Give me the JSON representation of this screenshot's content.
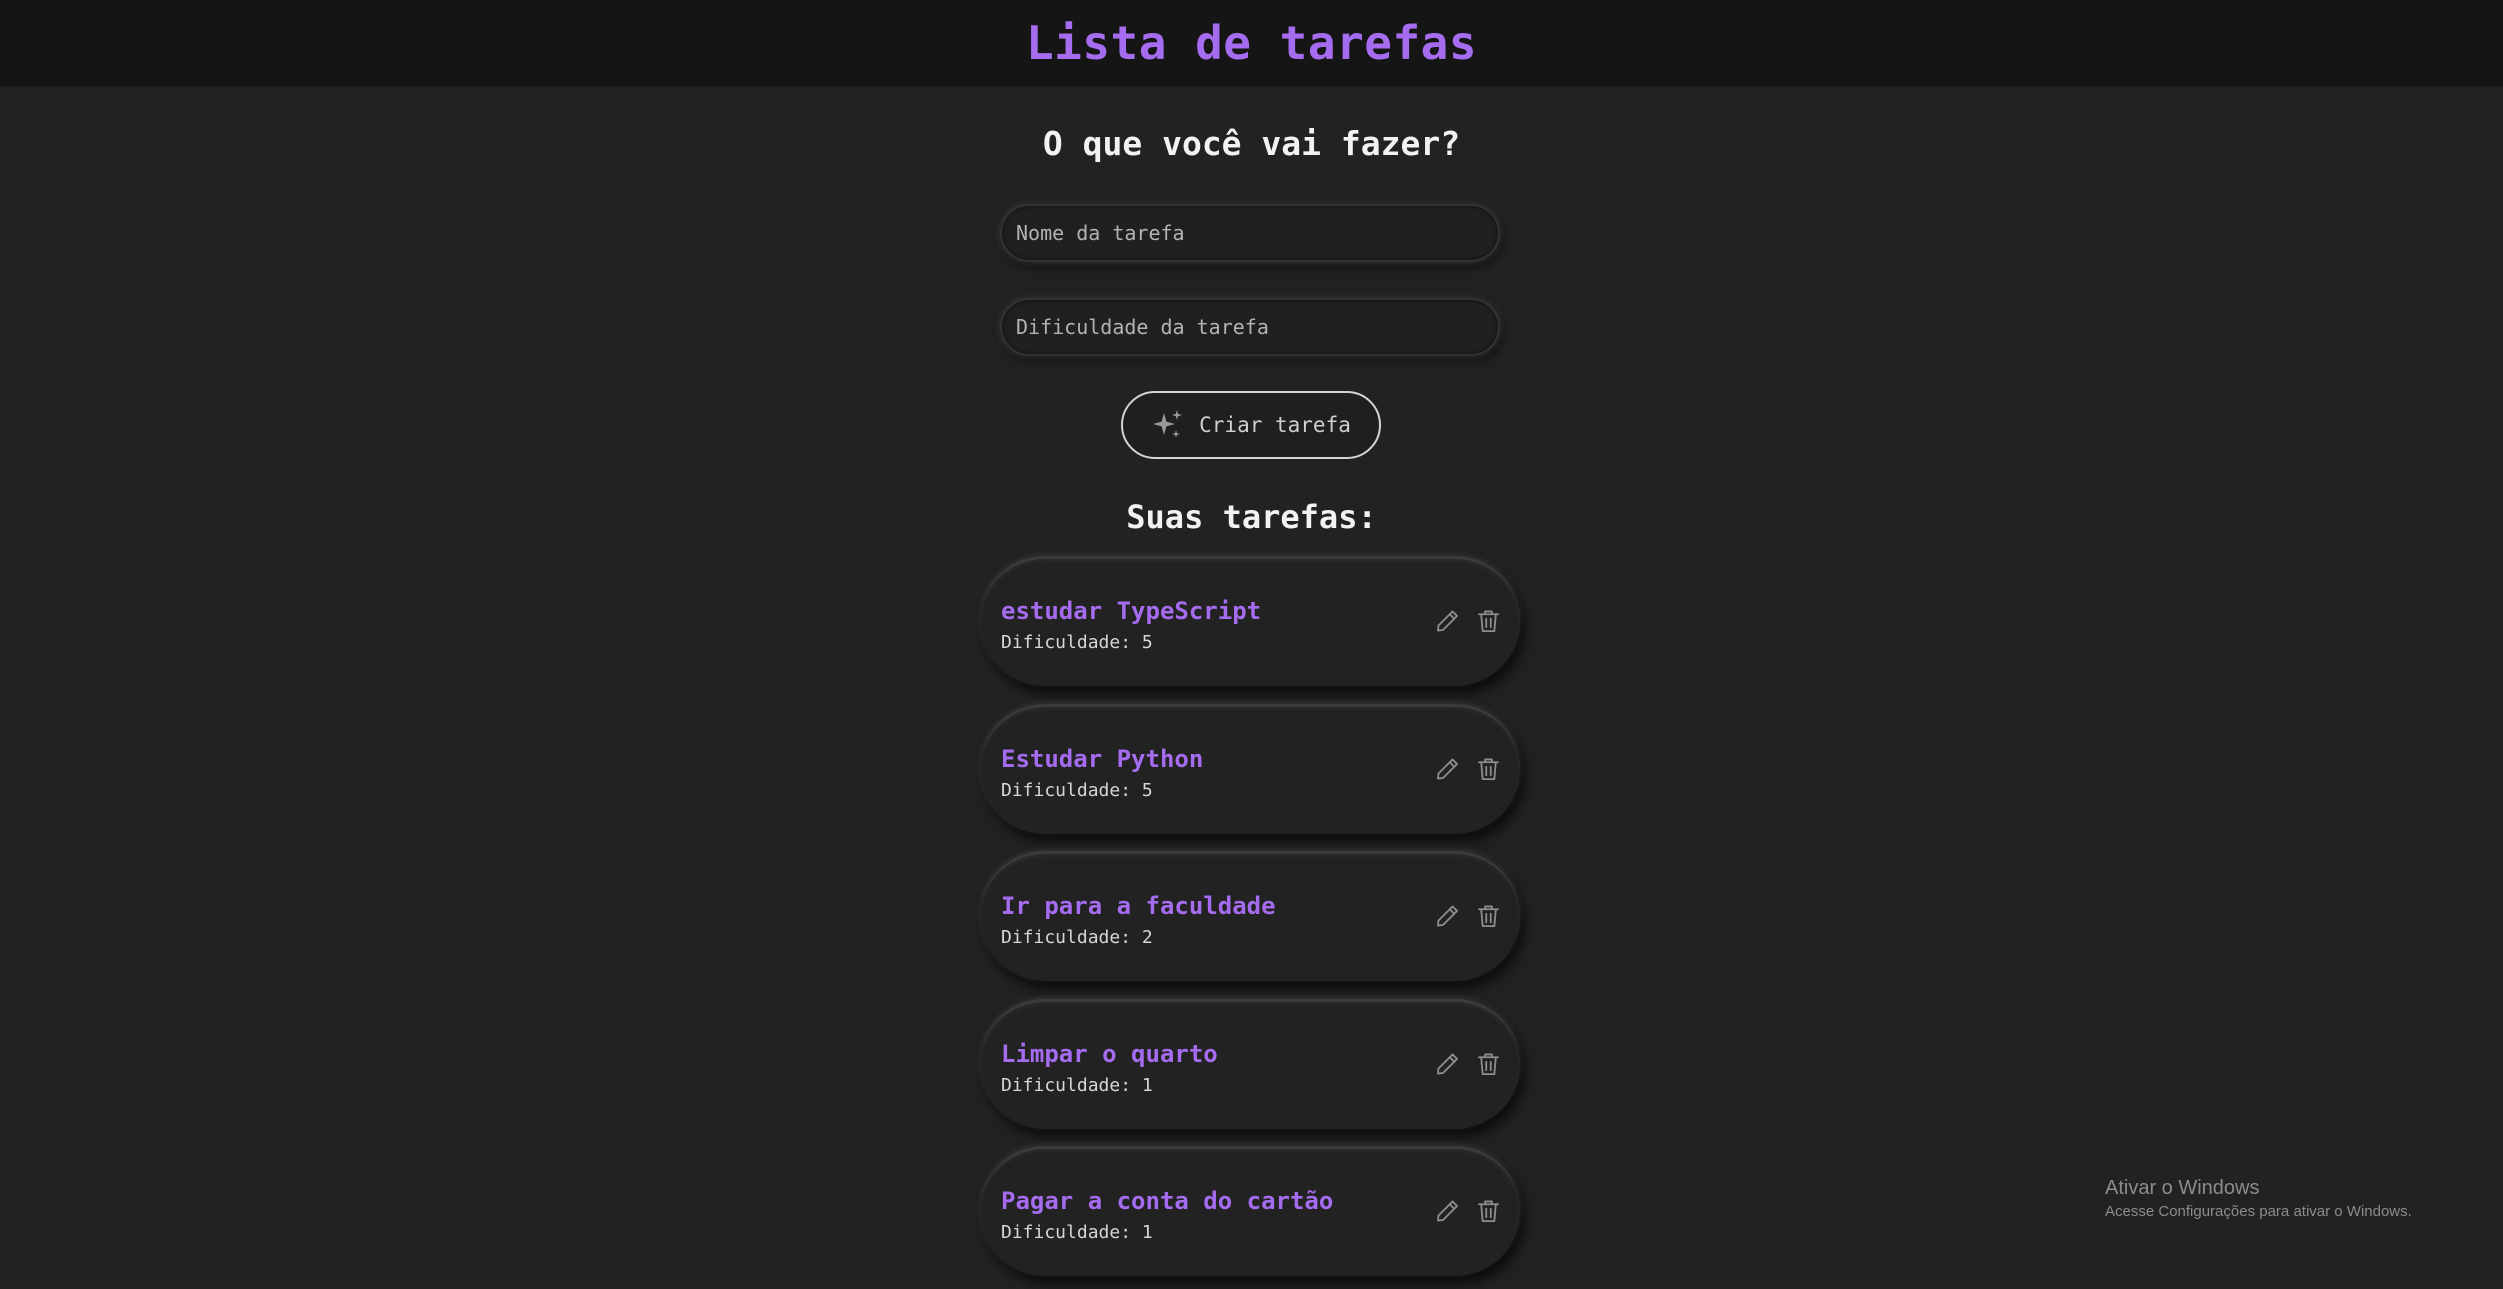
{
  "header": {
    "title": "Lista de tarefas"
  },
  "form": {
    "heading": "O que você vai fazer?",
    "name_placeholder": "Nome da tarefa",
    "difficulty_placeholder": "Dificuldade da tarefa",
    "create_label": "Criar tarefa",
    "create_icon": "sparkles-icon"
  },
  "list": {
    "heading": "Suas tarefas:",
    "tasks": [
      {
        "title": "estudar TypeScript",
        "difficulty": "Dificuldade: 5"
      },
      {
        "title": "Estudar Python",
        "difficulty": "Dificuldade: 5"
      },
      {
        "title": "Ir para a faculdade",
        "difficulty": "Dificuldade: 2"
      },
      {
        "title": "Limpar o quarto",
        "difficulty": "Dificuldade: 1"
      },
      {
        "title": "Pagar a conta do cartão",
        "difficulty": "Dificuldade: 1"
      }
    ],
    "edit_icon": "pencil-icon",
    "delete_icon": "trash-icon"
  },
  "watermark": {
    "title": "Ativar o Windows",
    "subtitle": "Acesse Configurações para ativar o Windows."
  },
  "colors": {
    "background": "#222222",
    "header_bg": "#151515",
    "accent": "#a56cf0",
    "text": "#f2f2f2",
    "muted": "#d6d6d6"
  }
}
